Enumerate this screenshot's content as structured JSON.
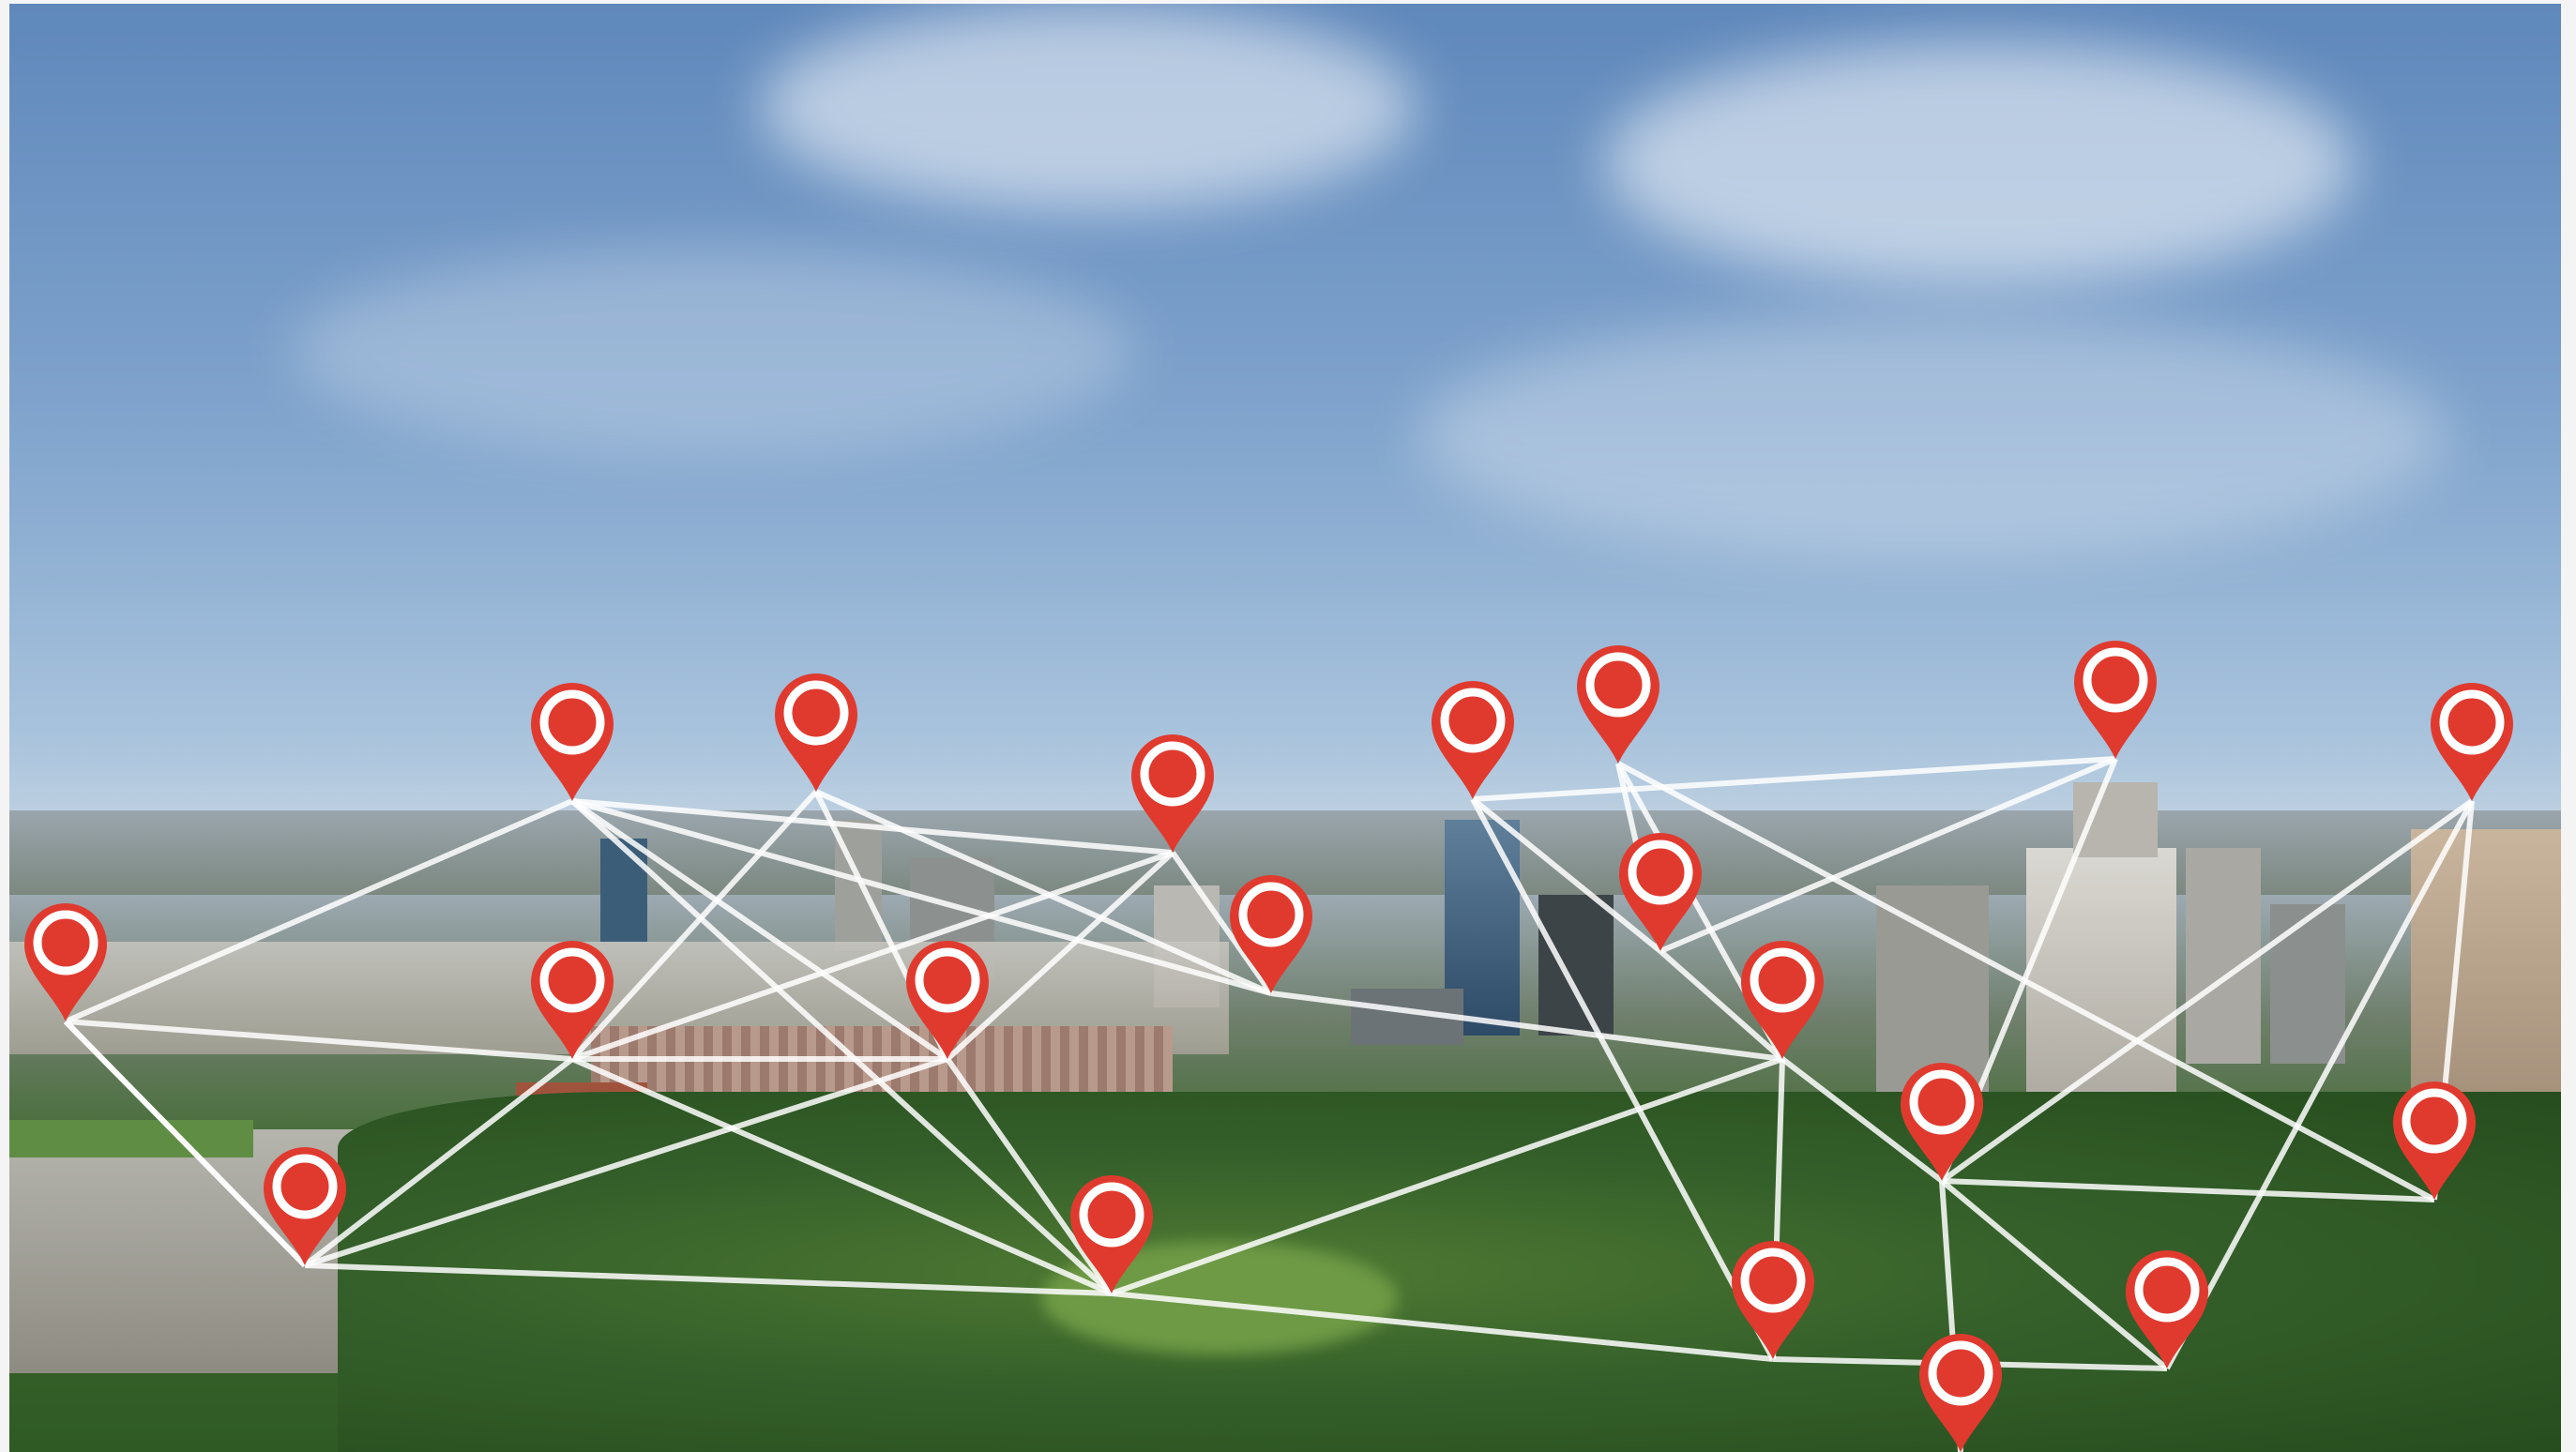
{
  "scene": {
    "description_free": true,
    "pin_color": "#e03a2f",
    "pin_hole_color": "#ffffff",
    "line_color": "#ffffff",
    "sky_top_color": "#5f88bb",
    "tree_color": "#2f5a24"
  }
}
